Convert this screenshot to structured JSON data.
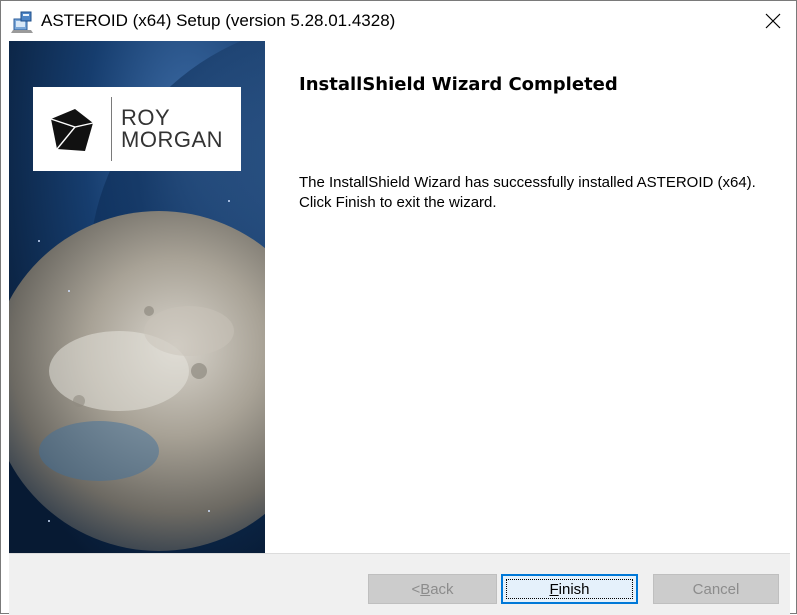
{
  "window": {
    "title": "ASTEROID (x64) Setup (version 5.28.01.4328)",
    "icon": "installer-icon",
    "close_glyph": "✕"
  },
  "brand": {
    "line1": "ROY",
    "line2": "MORGAN"
  },
  "content": {
    "heading": "InstallShield Wizard Completed",
    "body": "The InstallShield Wizard has successfully installed ASTEROID (x64). Click Finish to exit the wizard."
  },
  "buttons": {
    "back": {
      "prefix": "< ",
      "mnemonic": "B",
      "rest": "ack",
      "enabled": false
    },
    "finish": {
      "prefix": "",
      "mnemonic": "F",
      "rest": "inish",
      "enabled": true,
      "default": true
    },
    "cancel": {
      "label": "Cancel",
      "enabled": false
    }
  },
  "colors": {
    "accent": "#0078d7",
    "bar_bg": "#f0f0f0"
  }
}
